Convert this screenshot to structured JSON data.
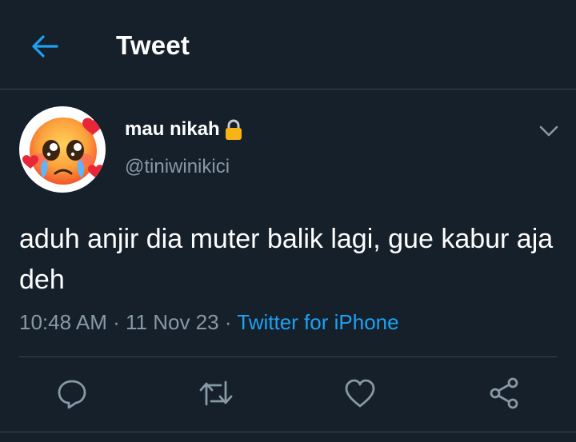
{
  "header": {
    "title": "Tweet",
    "back_icon": "arrow-left-icon"
  },
  "tweet": {
    "display_name": "mau nikah",
    "locked_icon": "lock-icon",
    "handle": "@tiniwinikici",
    "text": "aduh anjir dia muter balik lagi, gue kabur aja deh",
    "time": "10:48 AM",
    "date": "11 Nov 23",
    "separator": "·",
    "source": "Twitter for iPhone"
  },
  "actions": {
    "reply_icon": "reply-icon",
    "retweet_icon": "retweet-icon",
    "like_icon": "heart-icon",
    "share_icon": "share-icon"
  },
  "colors": {
    "background": "#15202b",
    "accent": "#1da1f2",
    "secondary_text": "#8899a6",
    "border": "#38444d"
  }
}
